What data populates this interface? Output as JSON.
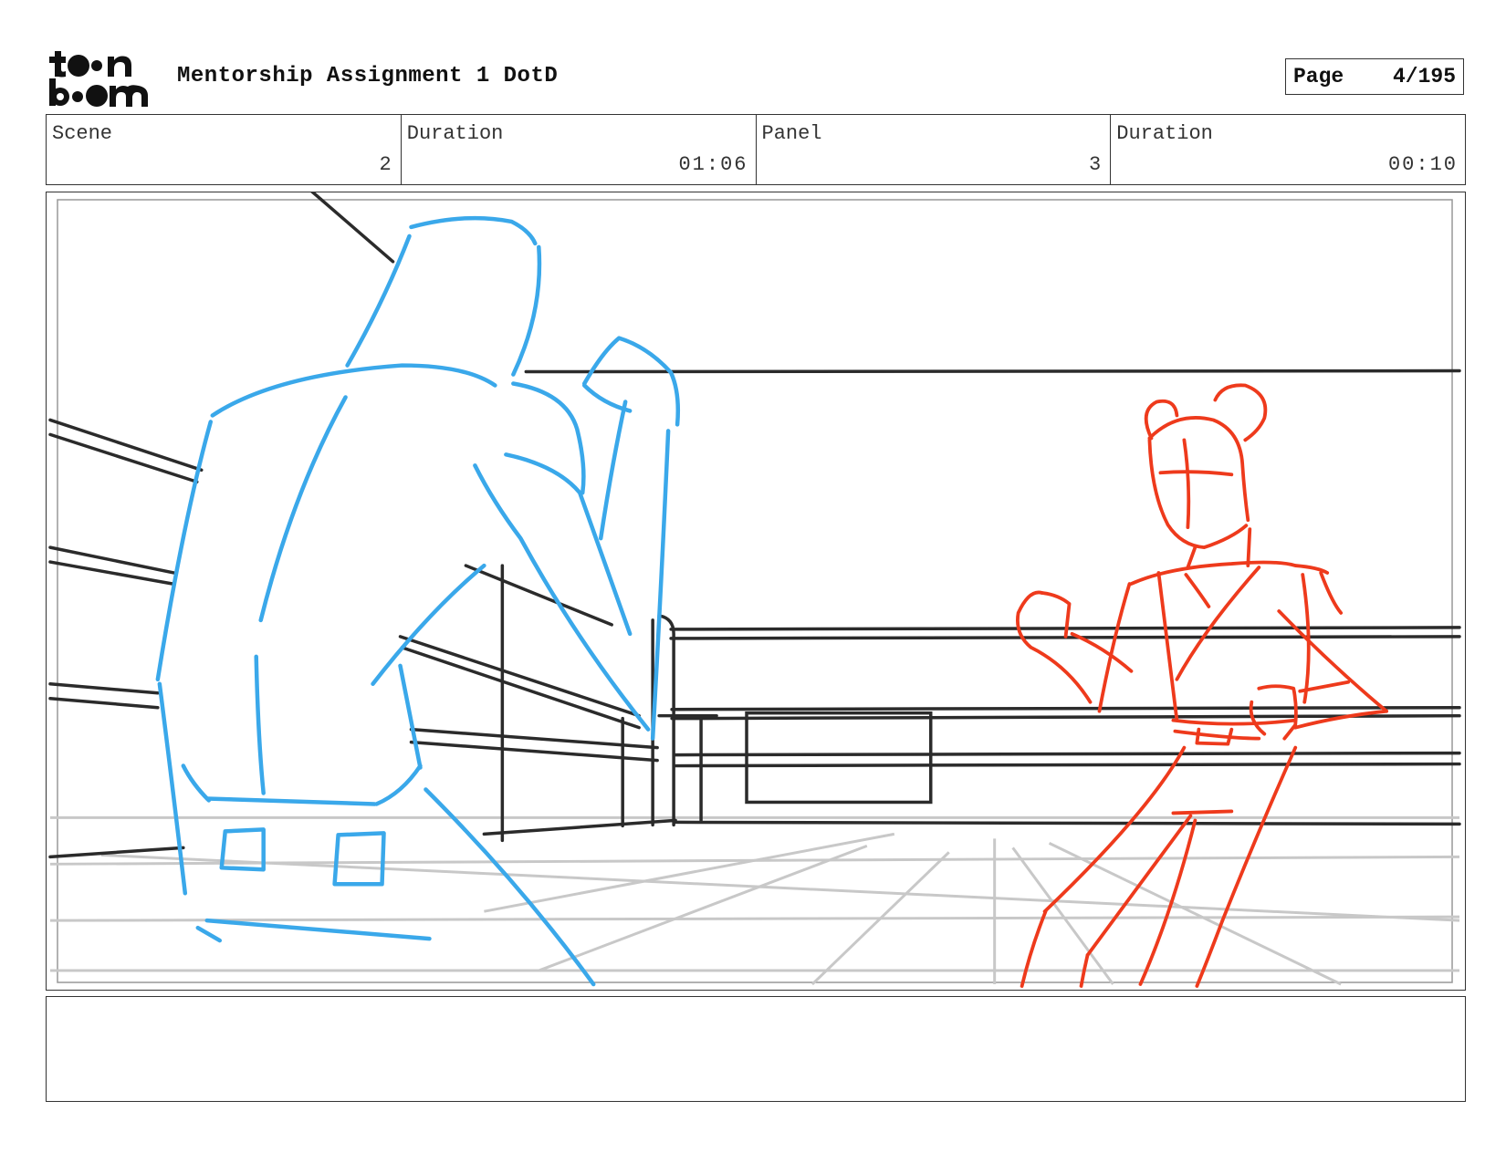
{
  "header": {
    "logo_name": "toon-boom-logo",
    "logo_text": "toon boom",
    "title": "Mentorship Assignment 1 DotD",
    "page_label": "Page",
    "page_value": "4/195"
  },
  "info": [
    {
      "label": "Scene",
      "value": "2"
    },
    {
      "label": "Duration",
      "value": "01:06"
    },
    {
      "label": "Panel",
      "value": "3"
    },
    {
      "label": "Duration",
      "value": "00:10"
    }
  ],
  "panel": {
    "sketch_colors": {
      "left_figure": "#3aa8ea",
      "right_figure": "#ee3a1c",
      "ring": "#2b2b2b",
      "floor": "#c8c8c8"
    }
  },
  "notes": {
    "text": ""
  }
}
